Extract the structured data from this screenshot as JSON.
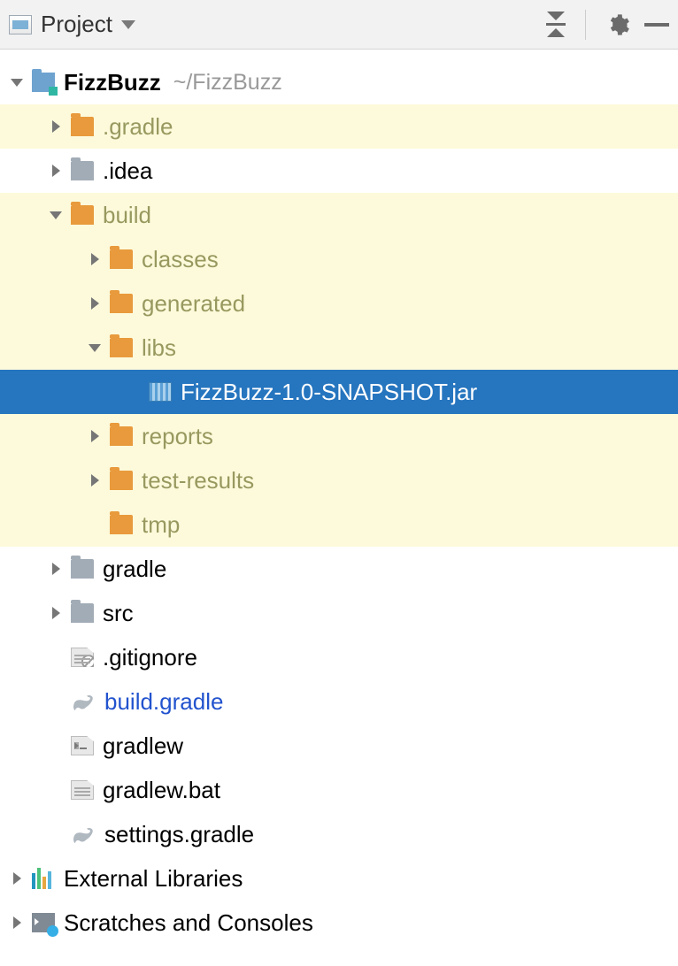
{
  "header": {
    "title": "Project"
  },
  "tree": {
    "project": {
      "name": "FizzBuzz",
      "path": "~/FizzBuzz"
    },
    "gradle_dir": ".gradle",
    "idea_dir": ".idea",
    "build": {
      "name": "build",
      "classes": "classes",
      "generated": "generated",
      "libs": "libs",
      "jar": "FizzBuzz-1.0-SNAPSHOT.jar",
      "reports": "reports",
      "test_results": "test-results",
      "tmp": "tmp"
    },
    "gradle_folder": "gradle",
    "src": "src",
    "gitignore": ".gitignore",
    "build_gradle": "build.gradle",
    "gradlew": "gradlew",
    "gradlew_bat": "gradlew.bat",
    "settings_gradle": "settings.gradle",
    "external_libs": "External Libraries",
    "scratches": "Scratches and Consoles"
  }
}
